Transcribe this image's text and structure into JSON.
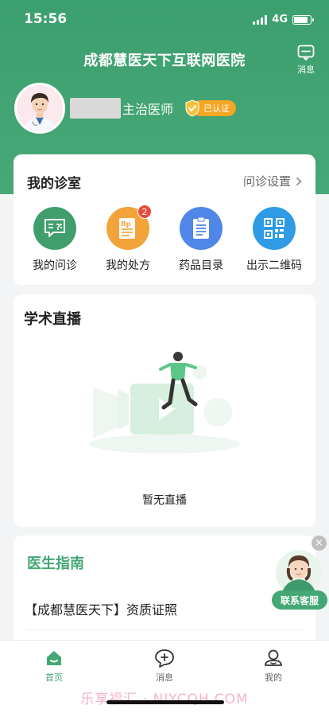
{
  "status_bar": {
    "time": "15:56",
    "network": "4G"
  },
  "header": {
    "title": "成都慧医天下互联网医院",
    "message_label": "消息"
  },
  "profile": {
    "title": "主治医师",
    "verified_label": "已认证"
  },
  "clinic": {
    "title": "我的诊室",
    "settings_label": "问诊设置",
    "features": [
      {
        "label": "我的问诊",
        "icon": "consult-icon",
        "color": "#3f9e6c"
      },
      {
        "label": "我的处方",
        "icon": "prescription-icon",
        "color": "#f2a33a",
        "badge": "2"
      },
      {
        "label": "药品目录",
        "icon": "drug-catalog-icon",
        "color": "#4f86e8"
      },
      {
        "label": "出示二维码",
        "icon": "qr-code-icon",
        "color": "#2f9be4"
      }
    ]
  },
  "live": {
    "title": "学术直播",
    "empty_text": "暂无直播"
  },
  "guide": {
    "title": "医生指南",
    "items": [
      {
        "label": "【成都慧医天下】资质证照"
      }
    ]
  },
  "customer_service": {
    "label": "联系客服"
  },
  "tabbar": {
    "items": [
      {
        "label": "首页",
        "icon": "home-icon",
        "active": true
      },
      {
        "label": "消息",
        "icon": "chat-plus-icon",
        "active": false
      },
      {
        "label": "我的",
        "icon": "profile-icon",
        "active": false
      }
    ]
  },
  "watermark": "乐享福汇 · NIYCQH.COM",
  "colors": {
    "brand_green": "#43a874",
    "badge_red": "#e74c3c",
    "verified_orange": "#f5a623"
  }
}
